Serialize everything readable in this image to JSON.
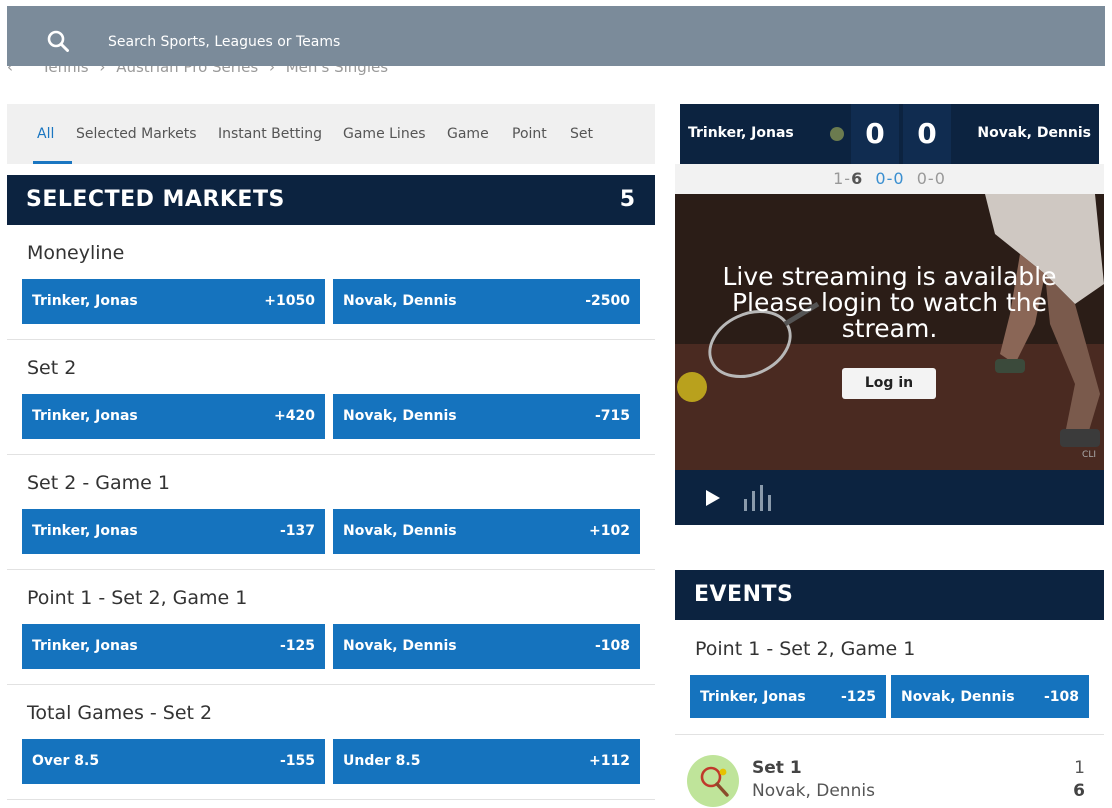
{
  "search": {
    "placeholder": "Search Sports, Leagues or Teams"
  },
  "breadcrumb": {
    "items": [
      "Tennis",
      "Austrian Pro Series",
      "Men's Singles"
    ]
  },
  "tabs": [
    "All",
    "Selected Markets",
    "Instant Betting",
    "Game Lines",
    "Game",
    "Point",
    "Set"
  ],
  "selected_markets": {
    "title": "SELECTED MARKETS",
    "count": "5",
    "markets": [
      {
        "title": "Moneyline",
        "left": {
          "name": "Trinker, Jonas",
          "odds": "+1050"
        },
        "right": {
          "name": "Novak, Dennis",
          "odds": "-2500"
        }
      },
      {
        "title": "Set 2",
        "left": {
          "name": "Trinker, Jonas",
          "odds": "+420"
        },
        "right": {
          "name": "Novak, Dennis",
          "odds": "-715"
        }
      },
      {
        "title": "Set 2 - Game 1",
        "left": {
          "name": "Trinker, Jonas",
          "odds": "-137"
        },
        "right": {
          "name": "Novak, Dennis",
          "odds": "+102"
        }
      },
      {
        "title": "Point 1 - Set 2, Game 1",
        "left": {
          "name": "Trinker, Jonas",
          "odds": "-125"
        },
        "right": {
          "name": "Novak, Dennis",
          "odds": "-108"
        }
      },
      {
        "title": "Total Games - Set 2",
        "left": {
          "name": "Over 8.5",
          "odds": "-155"
        },
        "right": {
          "name": "Under 8.5",
          "odds": "+112"
        }
      }
    ]
  },
  "scoreboard": {
    "player1": "Trinker, Jonas",
    "player2": "Novak, Dennis",
    "score1": "0",
    "score2": "0",
    "sets": {
      "set1_p1": "1",
      "set1_p2": "6",
      "set2_p1": "0",
      "set2_p2": "0",
      "game_p1": "0",
      "game_p2": "0"
    }
  },
  "stream": {
    "message_line1": "Live streaming is available",
    "message_line2": "Please login to watch the",
    "message_line3": "stream.",
    "login_label": "Log in",
    "watermark": "CLI"
  },
  "events": {
    "title": "EVENTS",
    "market": {
      "title": "Point 1 - Set 2, Game 1",
      "left": {
        "name": "Trinker, Jonas",
        "odds": "-125"
      },
      "right": {
        "name": "Novak, Dennis",
        "odds": "-108"
      }
    },
    "feed": [
      {
        "title": "Set 1",
        "subtitle": "Novak, Dennis",
        "score_top": "1",
        "score_bottom": "6"
      }
    ]
  },
  "colors": {
    "navy": "#0c2340",
    "bet_blue": "#1573be",
    "search_bg": "#7b8b9a",
    "accent": "#1a76c1"
  }
}
